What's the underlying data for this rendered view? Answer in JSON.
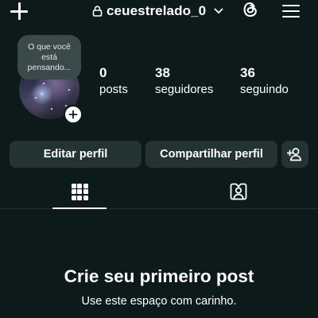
{
  "header": {
    "username": "ceuestrelado_0",
    "icons": {
      "create": "plus-icon",
      "private": "lock-icon",
      "switch_account": "chevron-down-icon",
      "threads": "threads-icon",
      "menu": "hamburger-menu-icon"
    }
  },
  "profile": {
    "note": "O que você está pensando...",
    "avatar_add_icon": "plus-icon",
    "stats": [
      {
        "value": "0",
        "label": "posts"
      },
      {
        "value": "38",
        "label": "seguidores"
      },
      {
        "value": "36",
        "label": "seguindo"
      }
    ]
  },
  "actions": {
    "edit_label": "Editar perfil",
    "share_label": "Compartilhar perfil",
    "discover_icon": "add-person-icon"
  },
  "tabs": [
    {
      "icon": "grid-icon",
      "active": true
    },
    {
      "icon": "tagged-person-icon",
      "active": false
    }
  ],
  "empty_state": {
    "title": "Crie seu primeiro post",
    "subtitle": "Use este espaço com carinho."
  },
  "colors": {
    "background": "#0c1b1a",
    "button": "#233332",
    "note_bubble": "#3a4a4a",
    "text": "#ffffff"
  }
}
